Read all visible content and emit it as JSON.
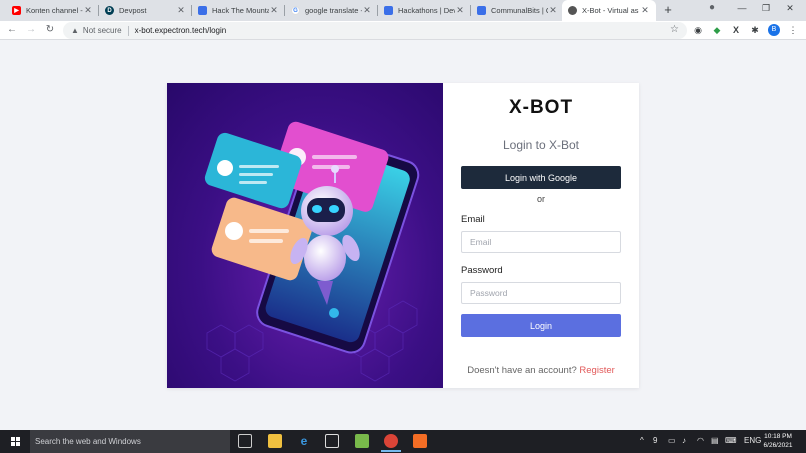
{
  "browser": {
    "tabs": [
      {
        "title": "Konten channel -",
        "icon": "youtube-icon",
        "color": "#ff0000",
        "active": false
      },
      {
        "title": "Devpost",
        "icon": "devpost-icon",
        "color": "#003e54",
        "active": false
      },
      {
        "title": "Hack The Mounta",
        "icon": "blue-doc-icon",
        "color": "#3b6fe8",
        "active": false
      },
      {
        "title": "google translate -",
        "icon": "google-icon",
        "color": "#4285f4",
        "active": false
      },
      {
        "title": "Hackathons | Dev",
        "icon": "blue-doc-icon",
        "color": "#3b6fe8",
        "active": false
      },
      {
        "title": "CommunalBits | C",
        "icon": "blue-doc-icon",
        "color": "#3b6fe8",
        "active": false
      },
      {
        "title": "X-Bot - Virtual as",
        "icon": "xbot-icon",
        "color": "#555555",
        "active": true
      }
    ],
    "security_label": "Not secure",
    "url": "x-bot.expectron.tech/login",
    "profile_initial": "B"
  },
  "page": {
    "brand": "X-BOT",
    "subtitle": "Login to X-Bot",
    "google_button": "Login with Google",
    "or_text": "or",
    "email_label": "Email",
    "email_placeholder": "Email",
    "password_label": "Password",
    "password_placeholder": "Password",
    "login_button": "Login",
    "signup_prompt": "Doesn't have an account?",
    "signup_link": "Register"
  },
  "taskbar": {
    "search_placeholder": "Search the web and Windows",
    "language": "ENG",
    "time": "10:18 PM",
    "date": "6/26/2021"
  }
}
